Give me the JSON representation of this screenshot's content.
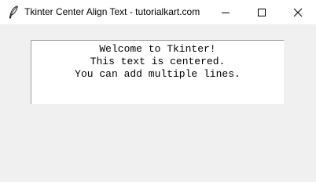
{
  "window": {
    "title": "Tkinter Center Align Text - tutorialkart.com",
    "controls": {
      "minimize_icon": "minimize-icon",
      "maximize_icon": "maximize-icon",
      "close_icon": "close-icon"
    },
    "app_icon": "tk-feather-icon"
  },
  "textbox": {
    "lines": [
      "Welcome to Tkinter!",
      "This text is centered.",
      "You can add multiple lines."
    ]
  },
  "colors": {
    "client_bg": "#f0f0f0",
    "titlebar_bg": "#ffffff",
    "text_bg": "#ffffff",
    "text": "#000000"
  }
}
